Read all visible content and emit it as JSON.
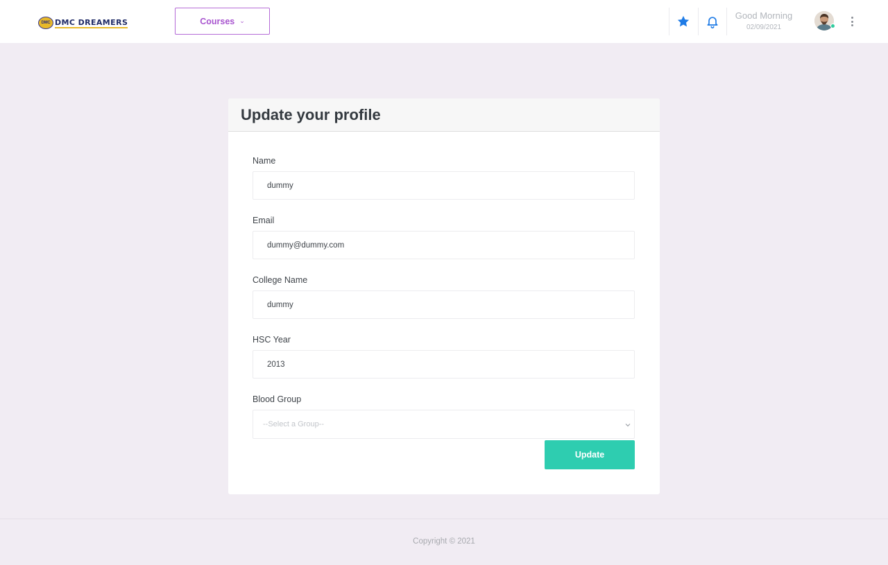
{
  "brand": {
    "badge_text": "DMC",
    "name": "DMC DREAMERS"
  },
  "header": {
    "courses_label": "Courses",
    "courses_chevron": "⌄",
    "greeting": "Good Morning",
    "date": "02/09/2021",
    "icons": {
      "favorite": "star-icon",
      "notifications": "bell-icon",
      "more": "kebab-menu-icon"
    }
  },
  "profile_form": {
    "title": "Update your profile",
    "fields": [
      {
        "label": "Name",
        "value": "dummy"
      },
      {
        "label": "Email",
        "value": "dummy@dummy.com"
      },
      {
        "label": "College Name",
        "value": "dummy"
      },
      {
        "label": "HSC Year",
        "value": "2013"
      }
    ],
    "blood_group": {
      "label": "Blood Group",
      "placeholder": "--Select a Group--"
    },
    "submit_label": "Update"
  },
  "footer": {
    "copyright": "Copyright © 2021"
  },
  "colors": {
    "accent_purple": "#a855cf",
    "accent_teal": "#2ecdb0",
    "icon_blue": "#1e7be6",
    "page_background": "#f1ecf3"
  }
}
